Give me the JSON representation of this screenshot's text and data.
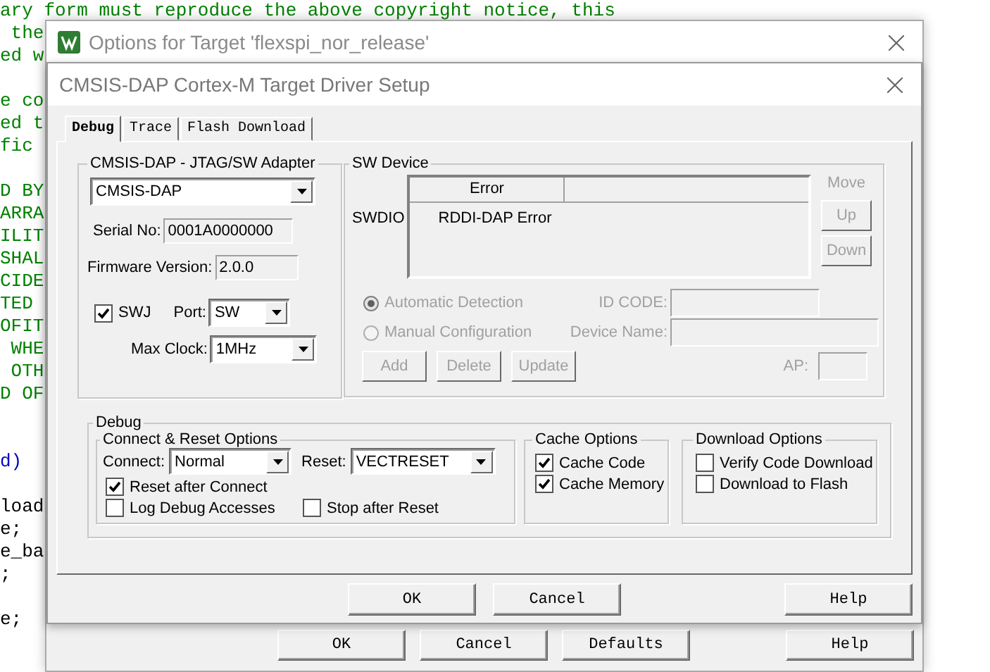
{
  "editor": {
    "lines": [
      {
        "kind": "comment",
        "text": "ary form must reproduce the above copyright notice, this"
      },
      {
        "kind": "comment",
        "text": " the"
      },
      {
        "kind": "comment",
        "text": "ed w"
      },
      {
        "kind": "blank"
      },
      {
        "kind": "comment",
        "text": "e co"
      },
      {
        "kind": "comment",
        "text": "ed t"
      },
      {
        "kind": "comment",
        "text": "fic "
      },
      {
        "kind": "blank"
      },
      {
        "kind": "comment",
        "text": "D BY"
      },
      {
        "kind": "comment",
        "text": "ARRA"
      },
      {
        "kind": "comment",
        "text": "ILIT"
      },
      {
        "kind": "comment",
        "text": "SHAL"
      },
      {
        "kind": "comment",
        "text": "CIDE"
      },
      {
        "kind": "comment",
        "text": "TED "
      },
      {
        "kind": "comment",
        "text": "OFIT"
      },
      {
        "kind": "comment",
        "text": " WHE"
      },
      {
        "kind": "comment",
        "text": " OTH"
      },
      {
        "kind": "comment",
        "text": "D OF"
      },
      {
        "kind": "blank"
      },
      {
        "kind": "blank"
      },
      {
        "kind": "keyword",
        "text": "d)"
      },
      {
        "kind": "blank"
      },
      {
        "kind": "code",
        "text": "load"
      },
      {
        "kind": "code",
        "text": "e;"
      },
      {
        "kind": "code",
        "text": "e_ba"
      },
      {
        "kind": "code",
        "text": ";"
      },
      {
        "kind": "blank"
      },
      {
        "kind": "code",
        "text": "e;"
      }
    ]
  },
  "outer_window": {
    "title": "Options for Target 'flexspi_nor_release'",
    "buttons": [
      "OK",
      "Cancel",
      "Defaults",
      "Help"
    ]
  },
  "dialog": {
    "title": "CMSIS-DAP Cortex-M Target Driver Setup",
    "tabs": [
      {
        "label": "Debug",
        "selected": true
      },
      {
        "label": "Trace",
        "selected": false
      },
      {
        "label": "Flash Download",
        "selected": false
      }
    ],
    "adapter": {
      "legend": "CMSIS-DAP - JTAG/SW Adapter",
      "adapter_value": "CMSIS-DAP",
      "serial_label": "Serial No:",
      "serial_value": "0001A0000000",
      "firmware_label": "Firmware Version:",
      "firmware_value": "2.0.0",
      "swj": {
        "label": "SWJ",
        "checked": true
      },
      "port_label": "Port:",
      "port_value": "SW",
      "clock_label": "Max Clock:",
      "clock_value": "1MHz"
    },
    "sw_device": {
      "legend": "SW Device",
      "disabled": true,
      "row_label": "SWDIO",
      "columns": [
        "Error"
      ],
      "rows": [
        [
          "RDDI-DAP Error"
        ]
      ],
      "move_label": "Move",
      "move_buttons": [
        "Up",
        "Down"
      ],
      "detection": [
        {
          "label": "Automatic Detection",
          "selected": true
        },
        {
          "label": "Manual Configuration",
          "selected": false
        }
      ],
      "id_code_label": "ID CODE:",
      "device_name_label": "Device Name:",
      "actions": [
        "Add",
        "Delete",
        "Update"
      ],
      "ap_label": "AP:"
    },
    "debug": {
      "legend": "Debug",
      "connect_reset": {
        "legend": "Connect & Reset Options",
        "connect_label": "Connect:",
        "connect_value": "Normal",
        "reset_label": "Reset:",
        "reset_value": "VECTRESET",
        "options": [
          {
            "label": "Reset after Connect",
            "checked": true
          },
          {
            "label": "Log Debug Accesses",
            "checked": false
          },
          {
            "label": "Stop after Reset",
            "checked": false
          }
        ]
      },
      "cache": {
        "legend": "Cache Options",
        "options": [
          {
            "label": "Cache Code",
            "checked": true
          },
          {
            "label": "Cache Memory",
            "checked": true
          }
        ]
      },
      "download": {
        "legend": "Download Options",
        "options": [
          {
            "label": "Verify Code Download",
            "checked": false
          },
          {
            "label": "Download to Flash",
            "checked": false
          }
        ]
      }
    },
    "buttons": [
      "OK",
      "Cancel",
      "Help"
    ]
  }
}
